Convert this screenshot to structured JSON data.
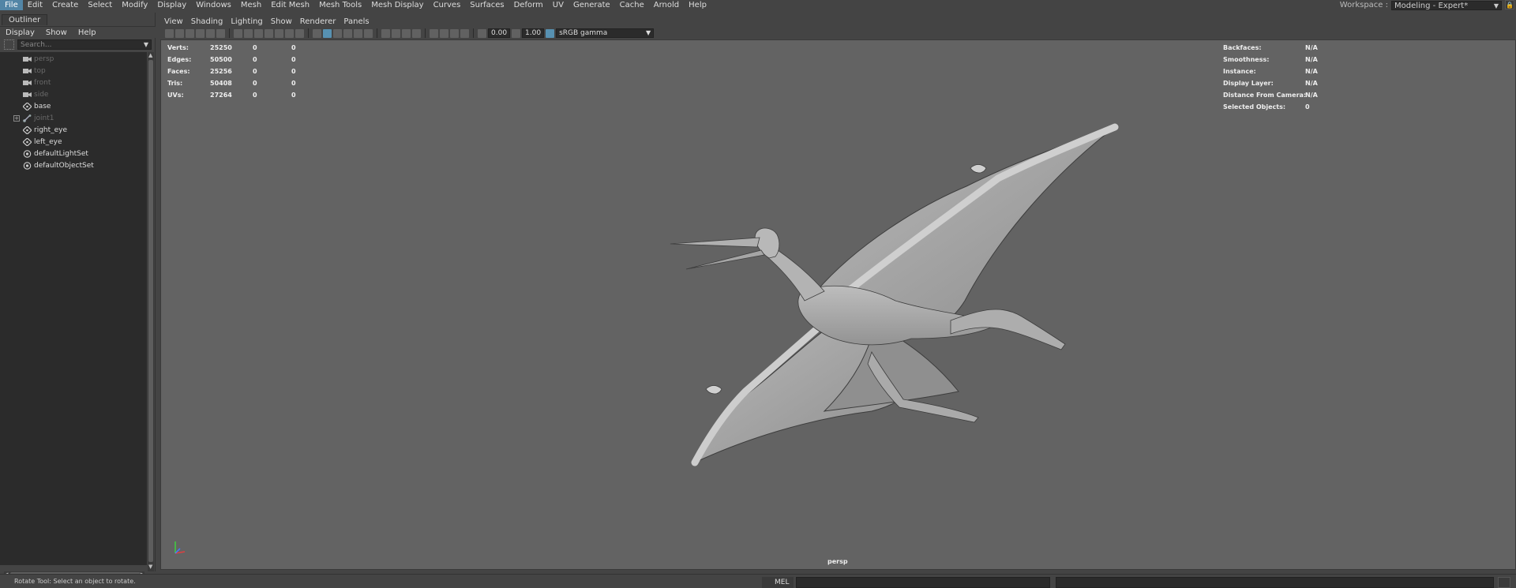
{
  "menubar": {
    "items": [
      "File",
      "Edit",
      "Create",
      "Select",
      "Modify",
      "Display",
      "Windows",
      "Mesh",
      "Edit Mesh",
      "Mesh Tools",
      "Mesh Display",
      "Curves",
      "Surfaces",
      "Deform",
      "UV",
      "Generate",
      "Cache",
      "Arnold",
      "Help"
    ],
    "active_item": "File",
    "workspace_label": "Workspace :",
    "workspace_value": "Modeling - Expert*"
  },
  "outliner": {
    "tab_label": "Outliner",
    "menu": [
      "Display",
      "Show",
      "Help"
    ],
    "search_placeholder": "Search...",
    "items": [
      {
        "label": "persp",
        "icon": "camera-icon",
        "dim": true
      },
      {
        "label": "top",
        "icon": "camera-icon",
        "dim": true
      },
      {
        "label": "front",
        "icon": "camera-icon",
        "dim": true
      },
      {
        "label": "side",
        "icon": "camera-icon",
        "dim": true
      },
      {
        "label": "base",
        "icon": "transform-icon",
        "dim": false
      },
      {
        "label": "joint1",
        "icon": "joint-icon",
        "dim": true,
        "expandable": true
      },
      {
        "label": "right_eye",
        "icon": "transform-icon",
        "dim": false
      },
      {
        "label": "left_eye",
        "icon": "transform-icon",
        "dim": false
      },
      {
        "label": "defaultLightSet",
        "icon": "set-icon",
        "dim": false
      },
      {
        "label": "defaultObjectSet",
        "icon": "set-icon",
        "dim": false
      }
    ]
  },
  "viewport": {
    "menu": [
      "View",
      "Shading",
      "Lighting",
      "Show",
      "Renderer",
      "Panels"
    ],
    "exposure": "0.00",
    "gamma": "1.00",
    "color_management": "sRGB gamma",
    "camera_name": "persp",
    "hud_left": [
      {
        "label": "Verts:",
        "v1": "25250",
        "v2": "0",
        "v3": "0"
      },
      {
        "label": "Edges:",
        "v1": "50500",
        "v2": "0",
        "v3": "0"
      },
      {
        "label": "Faces:",
        "v1": "25256",
        "v2": "0",
        "v3": "0"
      },
      {
        "label": "Tris:",
        "v1": "50408",
        "v2": "0",
        "v3": "0"
      },
      {
        "label": "UVs:",
        "v1": "27264",
        "v2": "0",
        "v3": "0"
      }
    ],
    "hud_right": [
      {
        "label": "Backfaces:",
        "value": "N/A"
      },
      {
        "label": "Smoothness:",
        "value": "N/A"
      },
      {
        "label": "Instance:",
        "value": "N/A"
      },
      {
        "label": "Display Layer:",
        "value": "N/A"
      },
      {
        "label": "Distance From Camera:",
        "value": "N/A"
      },
      {
        "label": "Selected Objects:",
        "value": "0"
      }
    ],
    "colors": {
      "background": "#636363",
      "model": "#a9a9a9",
      "accent": "#5285a6"
    }
  },
  "helpline": {
    "text": "Rotate Tool: Select an object to rotate.",
    "mel_label": "MEL"
  }
}
